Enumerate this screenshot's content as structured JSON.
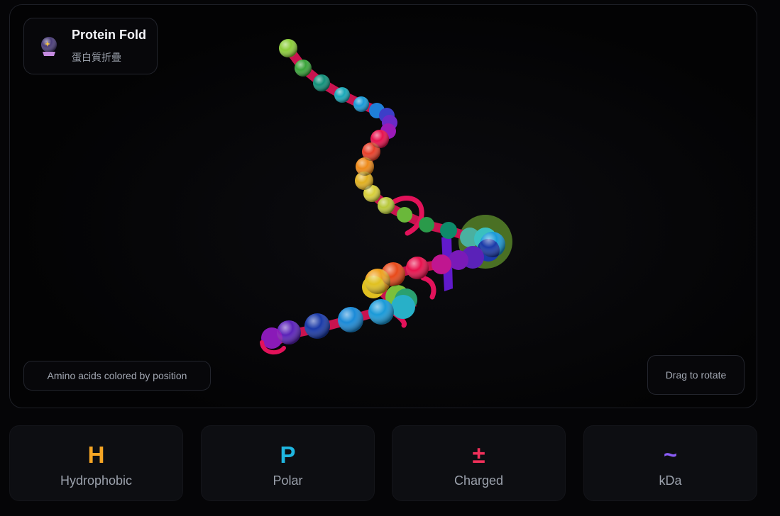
{
  "header": {
    "title": "Protein Fold",
    "subtitle": "蛋白質折疊",
    "icon": "crystal-ball-icon"
  },
  "viewer": {
    "legend_text": "Amino acids colored by position",
    "rotate_hint": "Drag to rotate"
  },
  "stats": [
    {
      "glyph": "H",
      "label": "Hydrophobic",
      "color": "#f5a524"
    },
    {
      "glyph": "P",
      "label": "Polar",
      "color": "#1fb6e0"
    },
    {
      "glyph": "±",
      "label": "Charged",
      "color": "#f0305a"
    },
    {
      "glyph": "~",
      "label": "kDa",
      "color": "#8a5cf6"
    }
  ],
  "colors": {
    "backbone": "#c9134f",
    "background": "#050507",
    "card": "#0d0e12"
  }
}
